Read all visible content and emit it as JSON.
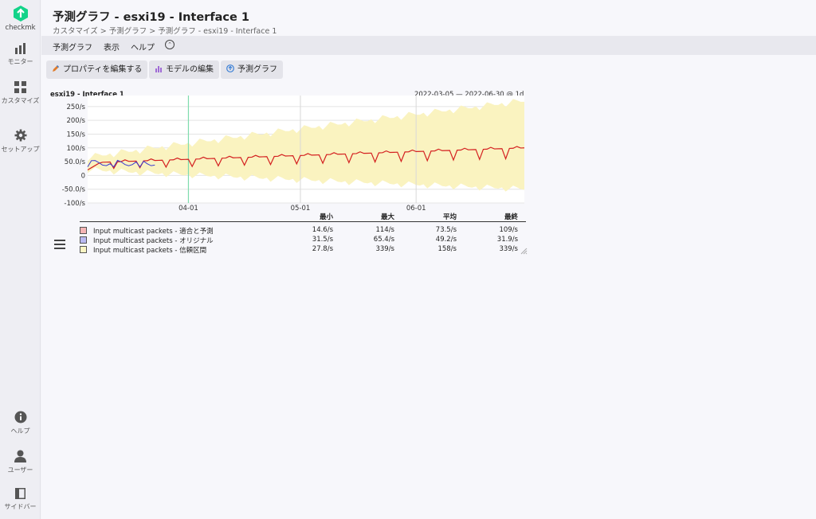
{
  "sidebar": {
    "logo_label": "checkmk",
    "items": [
      {
        "label": "モニター",
        "icon": "bar-chart-icon"
      },
      {
        "label": "カスタマイズ",
        "icon": "grid-icon"
      },
      {
        "label": "セットアップ",
        "icon": "gear-icon"
      }
    ],
    "bottom": [
      {
        "label": "ヘルプ",
        "icon": "info-icon"
      },
      {
        "label": "ユーザー",
        "icon": "user-icon"
      },
      {
        "label": "サイドバー",
        "icon": "sidebar-toggle-icon"
      }
    ]
  },
  "page": {
    "title": "予測グラフ - esxi19 - Interface 1",
    "breadcrumb": "カスタマイズ > 予測グラフ > 予測グラフ - esxi19 - Interface 1"
  },
  "menu": {
    "items": [
      "予測グラフ",
      "表示",
      "ヘルプ"
    ]
  },
  "toolbar": {
    "edit_properties": "プロパティを編集する",
    "edit_model": "モデルの編集",
    "forecast_graph": "予測グラフ"
  },
  "colors": {
    "accent": "#13d389",
    "fit_line": "#d42020",
    "original_line": "#3a3ad0",
    "confidence_fill": "#faf3c0",
    "marker_line": "#7fdcae"
  },
  "chart_data": {
    "type": "area",
    "title": "esxi19 - Interface 1",
    "time_range": "2022-03-05 — 2022-06-30 @ 1d",
    "x_start": "2022-03-05",
    "x_end": "2022-06-30",
    "x_ticks": [
      "04-01",
      "05-01",
      "06-01"
    ],
    "y_ticks": [
      "250/s",
      "200/s",
      "150/s",
      "100/s",
      "50.0/s",
      "0",
      "-50.0/s",
      "-100/s"
    ],
    "ylim": [
      -100,
      290
    ],
    "forecast_start": "04-01",
    "grid": true,
    "series": [
      {
        "name": "Input multicast packets - 適合と予測",
        "color": "#d42020",
        "min": "14.6/s",
        "max": "114/s",
        "avg": "73.5/s",
        "last": "109/s",
        "trend": {
          "start": 46,
          "end": 100,
          "weekly_dip": 38
        }
      },
      {
        "name": "Input multicast packets - オリジナル",
        "color": "#3a3ad0",
        "min": "31.5/s",
        "max": "65.4/s",
        "avg": "49.2/s",
        "last": "31.9/s"
      },
      {
        "name": "Input multicast packets - 信頼区間",
        "color": "#faf3c0",
        "min": "27.8/s",
        "max": "339/s",
        "avg": "158/s",
        "last": "339/s",
        "band": {
          "upper_start": 70,
          "upper_end": 275,
          "lower_start": 25,
          "lower_end": -45
        }
      }
    ]
  },
  "legend": {
    "headers": [
      "最小",
      "最大",
      "平均",
      "最終"
    ]
  }
}
